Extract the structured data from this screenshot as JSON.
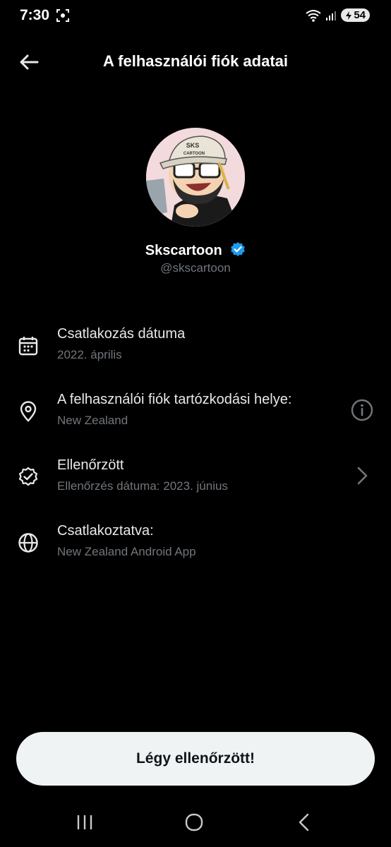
{
  "status_bar": {
    "time": "7:30",
    "battery": "54",
    "icons": [
      "screen-capture-icon",
      "wifi-icon",
      "signal-icon",
      "battery-icon"
    ]
  },
  "header": {
    "title": "A felhasználói fiók adatai",
    "back_icon": "arrow-left-icon"
  },
  "profile": {
    "name": "Skscartoon",
    "handle": "@skscartoon",
    "verified": true,
    "avatar_cap_text": "SKS CARTOON"
  },
  "info_rows": [
    {
      "icon": "calendar-icon",
      "title": "Csatlakozás dátuma",
      "subtitle": "2022. április"
    },
    {
      "icon": "location-pin-icon",
      "title": "A felhasználói fiók tartózkodási helye:",
      "subtitle": "New Zealand",
      "trailing": "info-icon"
    },
    {
      "icon": "verified-badge-outline-icon",
      "title": "Ellenőrzött",
      "subtitle": "Ellenőrzés dátuma: 2023. június",
      "trailing": "chevron-right-icon"
    },
    {
      "icon": "globe-icon",
      "title": "Csatlakoztatva:",
      "subtitle": "New Zealand Android App"
    }
  ],
  "cta": {
    "label": "Légy ellenőrzött!"
  },
  "nav_bar": {
    "items": [
      "recent-apps-icon",
      "home-icon",
      "back-icon"
    ]
  },
  "colors": {
    "background": "#000000",
    "primary_text": "#e7e9ea",
    "secondary_text": "#71767b",
    "verified_blue": "#1d9bf0",
    "button_bg": "#eff3f4"
  }
}
